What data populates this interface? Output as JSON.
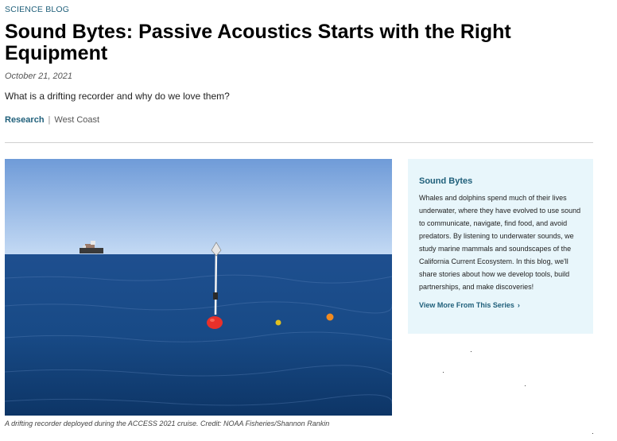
{
  "article": {
    "kicker": "SCIENCE BLOG",
    "title": "Sound Bytes: Passive Acoustics Starts with the Right Equipment",
    "date": "October 21, 2021",
    "subtitle": "What is a drifting recorder and why do we love them?",
    "tags": {
      "primary": "Research",
      "secondary": "West Coast"
    }
  },
  "photo": {
    "caption": "A drifting recorder deployed during the ACCESS 2021 cruise. Credit: NOAA Fisheries/Shannon Rankin",
    "colors": {
      "sky_top": "#6f9bd8",
      "sky_bottom": "#c4daf4",
      "sea_top": "#1e4f8f",
      "sea_bottom": "#0d3566",
      "buoy": "#e8302a",
      "float_yellow": "#e0c020",
      "float_orange": "#f08a20"
    }
  },
  "sidebar": {
    "heading": "Sound Bytes",
    "body": "Whales and dolphins spend much of their lives underwater, where they have evolved to use sound to communicate, navigate, find food, and avoid predators. By listening to underwater sounds, we study marine mammals and soundscapes of the California Current Ecosystem. In this blog, we'll share stories about how we develop tools, build partnerships, and make discoveries!",
    "link_label": "View More From This Series",
    "link_icon": "chevron-right-icon",
    "background": "#e8f6fb",
    "accent": "#1f5f7a"
  }
}
